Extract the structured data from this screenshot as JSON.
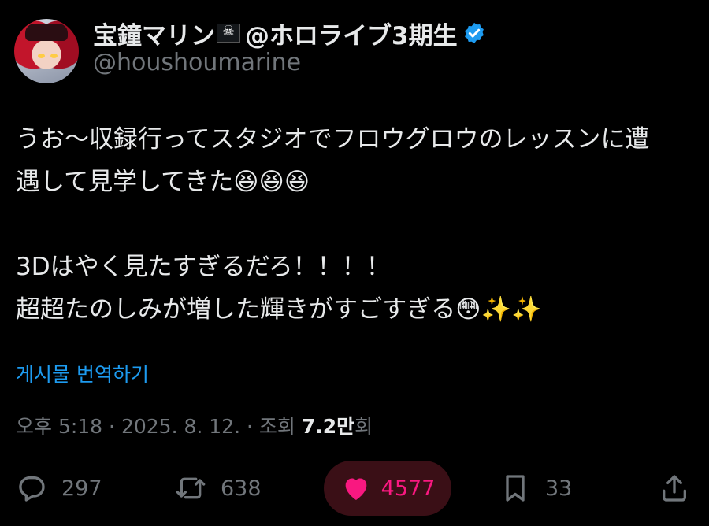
{
  "profile": {
    "display_name": "宝鐘マリン",
    "display_name_suffix": "@ホロライブ3期生",
    "handle": "@houshoumarine"
  },
  "tweet": {
    "text": "うお～収録行ってスタジオでフロウグロウのレッスンに遭\n遇して見学してきた😆😆😆\n\n3Dはやく見たすぎるだろ！！！！\n超超たのしみが増した輝きがすごすぎる😳✨✨",
    "translate_label": "게시물 번역하기"
  },
  "meta": {
    "time": "오후 5:18",
    "date": "2025. 8. 12.",
    "views_label": "조회",
    "views_value": "7.2만",
    "views_suffix": "회"
  },
  "actions": {
    "reply_count": "297",
    "retweet_count": "638",
    "like_count": "4577",
    "bookmark_count": "33"
  },
  "colors": {
    "background": "#000000",
    "text": "#e7e9ea",
    "muted": "#71767b",
    "link": "#1d9bf0",
    "like": "#f91880",
    "verified": "#1d9bf0"
  },
  "icons": [
    "flag-icon",
    "verified-icon",
    "reply-icon",
    "retweet-icon",
    "like-icon",
    "bookmark-icon",
    "share-icon"
  ]
}
